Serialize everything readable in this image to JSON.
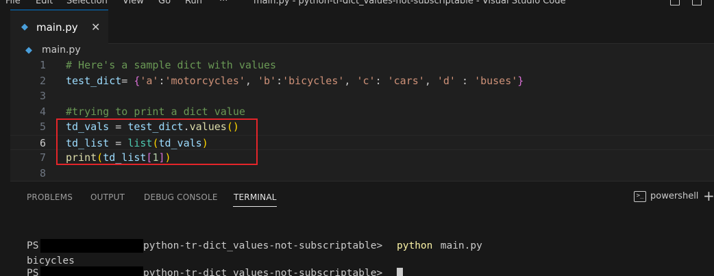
{
  "window": {
    "title": "main.py - python-tr-dict_values-not-subscriptable - Visual Studio Code",
    "menu": [
      "File",
      "Edit",
      "Selection",
      "View",
      "Go",
      "Run",
      "···"
    ]
  },
  "tab": {
    "label": "main.py",
    "close": "✕",
    "icon": "python-icon"
  },
  "breadcrumb": {
    "label": "main.py"
  },
  "editor": {
    "active_line": 6,
    "lines": [
      {
        "n": "1",
        "tokens": [
          {
            "t": "# Here's a sample dict with values",
            "c": "comment"
          }
        ]
      },
      {
        "n": "2",
        "tokens": [
          {
            "t": "test_dict",
            "c": "var"
          },
          {
            "t": "= ",
            "c": "plain"
          },
          {
            "t": "{",
            "c": "brace"
          },
          {
            "t": "'a'",
            "c": "str"
          },
          {
            "t": ":",
            "c": "plain"
          },
          {
            "t": "'motorcycles'",
            "c": "str"
          },
          {
            "t": ", ",
            "c": "plain"
          },
          {
            "t": "'b'",
            "c": "str"
          },
          {
            "t": ":",
            "c": "plain"
          },
          {
            "t": "'bicycles'",
            "c": "str"
          },
          {
            "t": ", ",
            "c": "plain"
          },
          {
            "t": "'c'",
            "c": "str"
          },
          {
            "t": ": ",
            "c": "plain"
          },
          {
            "t": "'cars'",
            "c": "str"
          },
          {
            "t": ", ",
            "c": "plain"
          },
          {
            "t": "'d'",
            "c": "str"
          },
          {
            "t": " : ",
            "c": "plain"
          },
          {
            "t": "'buses'",
            "c": "str"
          },
          {
            "t": "}",
            "c": "brace"
          }
        ]
      },
      {
        "n": "3",
        "tokens": []
      },
      {
        "n": "4",
        "tokens": [
          {
            "t": "#trying to print a dict value",
            "c": "comment"
          }
        ]
      },
      {
        "n": "5",
        "tokens": [
          {
            "t": "td_vals",
            "c": "var"
          },
          {
            "t": " = ",
            "c": "plain"
          },
          {
            "t": "test_dict",
            "c": "var"
          },
          {
            "t": ".",
            "c": "plain"
          },
          {
            "t": "values",
            "c": "func"
          },
          {
            "t": "()",
            "c": "paren"
          }
        ]
      },
      {
        "n": "6",
        "tokens": [
          {
            "t": "td_list",
            "c": "var"
          },
          {
            "t": " = ",
            "c": "plain"
          },
          {
            "t": "list",
            "c": "cls"
          },
          {
            "t": "(",
            "c": "paren"
          },
          {
            "t": "td_vals",
            "c": "var"
          },
          {
            "t": ")",
            "c": "paren"
          }
        ]
      },
      {
        "n": "7",
        "tokens": [
          {
            "t": "print",
            "c": "func"
          },
          {
            "t": "(",
            "c": "paren"
          },
          {
            "t": "td_list",
            "c": "var"
          },
          {
            "t": "[",
            "c": "bracket"
          },
          {
            "t": "1",
            "c": "num"
          },
          {
            "t": "]",
            "c": "bracket"
          },
          {
            "t": ")",
            "c": "paren"
          }
        ]
      },
      {
        "n": "8",
        "tokens": []
      }
    ]
  },
  "panel": {
    "tabs": [
      "PROBLEMS",
      "OUTPUT",
      "DEBUG CONSOLE",
      "TERMINAL"
    ],
    "active_tab": "TERMINAL",
    "shell_icon_glyph": ">_",
    "shell_label": "powershell",
    "add_glyph": "+"
  },
  "terminal": {
    "line1_ps": "PS",
    "line1_path": "python-tr-dict_values-not-subscriptable>",
    "line1_cmd": "python",
    "line1_arg": " main.py",
    "output": "bicycles",
    "line3_ps": "PS",
    "line3_path": "python-tr-dict_values-not-subscriptable>"
  },
  "colors": {
    "accent": "#0078d4",
    "annotation": "#e5252a"
  }
}
